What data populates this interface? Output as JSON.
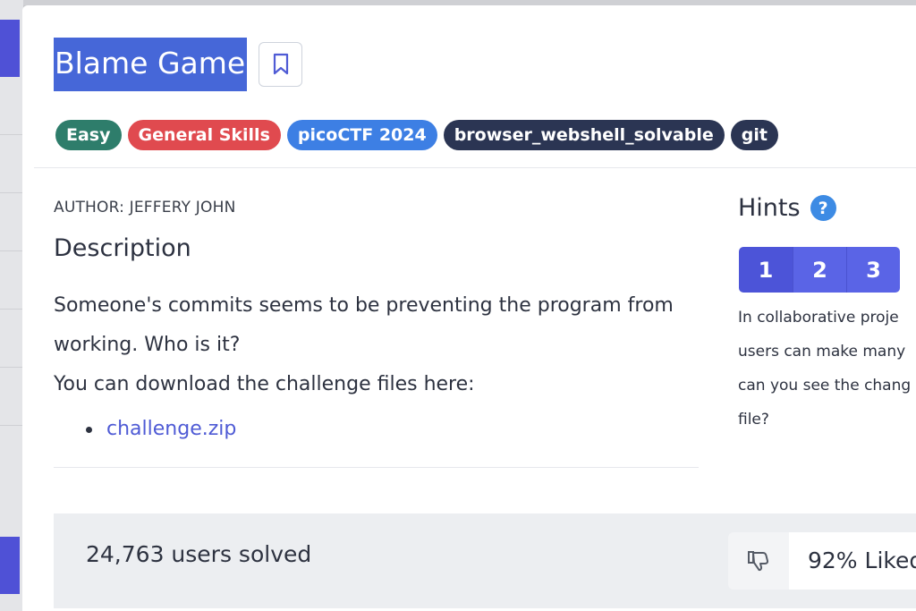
{
  "challenge": {
    "title": "Blame Game",
    "tags": [
      {
        "label": "Easy",
        "color": "#2e7d6b"
      },
      {
        "label": "General Skills",
        "color": "#e04a4f"
      },
      {
        "label": "picoCTF 2024",
        "color": "#3d7fe4"
      },
      {
        "label": "browser_webshell_solvable",
        "color": "#2b3553"
      },
      {
        "label": "git",
        "color": "#2b3553"
      }
    ],
    "author": "AUTHOR: JEFFERY JOHN",
    "description_heading": "Description",
    "description_lines": [
      "Someone's commits seems to be preventing the program from",
      "working. Who is it?",
      "You can download the challenge files here:"
    ],
    "file_link": "challenge.zip"
  },
  "hints": {
    "title": "Hints",
    "help_glyph": "?",
    "tabs": [
      "1",
      "2",
      "3"
    ],
    "active_tab": "1",
    "text_lines": [
      "In collaborative proje",
      "users can make many",
      "can you see the chang",
      "file?"
    ]
  },
  "stats": {
    "solved": "24,763 users solved",
    "liked": "92% Liked"
  },
  "colors": {
    "accent": "#5a64e6",
    "link": "#4f5bd5",
    "title_highlight": "#4667d8"
  }
}
